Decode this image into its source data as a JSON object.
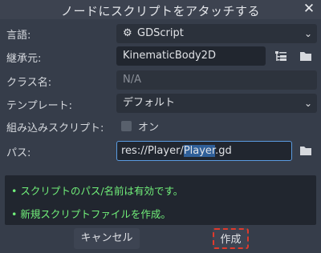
{
  "dialog": {
    "title": "ノードにスクリプトをアタッチする",
    "close_icon": "close-icon"
  },
  "form": {
    "language_label": "言語:",
    "language_value": "GDScript",
    "inherits_label": "継承元:",
    "inherits_value": "KinematicBody2D",
    "class_name_label": "クラス名:",
    "class_name_value": "N/A",
    "template_label": "テンプレート:",
    "template_value": "デフォルト",
    "builtin_label": "組み込みスクリプト:",
    "builtin_value": "オン",
    "path_label": "パス:",
    "path_prefix": "res://Player/",
    "path_selected": "Player",
    "path_suffix": ".gd"
  },
  "messages": [
    "• スクリプトのパス/名前は有効です。",
    "• 新規スクリプトファイルを作成。"
  ],
  "buttons": {
    "cancel": "キャンセル",
    "create": "作成"
  },
  "colors": {
    "valid_message": "#71f07a",
    "focus_border": "#5a9be0",
    "highlight_dash": "#e03a2c"
  }
}
